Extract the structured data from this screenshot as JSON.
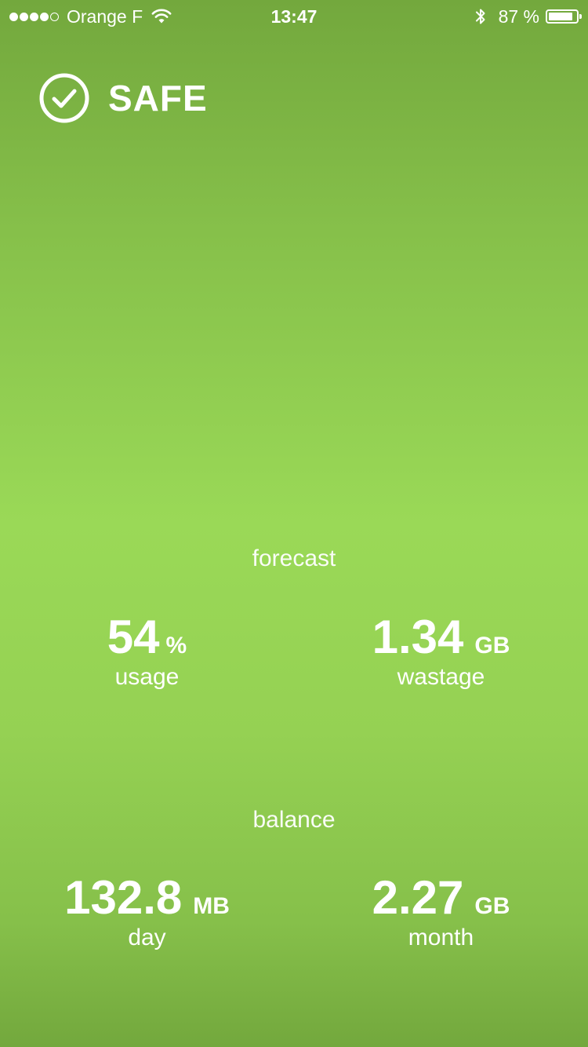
{
  "status_bar": {
    "carrier": "Orange F",
    "signal_bars_filled": 4,
    "signal_bars_total": 5,
    "time": "13:47",
    "battery_percent_text": "87 %",
    "battery_level": 0.87,
    "icons": [
      "wifi-icon",
      "bluetooth-icon",
      "battery-icon"
    ]
  },
  "header": {
    "status": "SAFE",
    "icon": "checkmark-circle-icon"
  },
  "forecast": {
    "title": "forecast",
    "usage": {
      "value": "54",
      "unit": "%",
      "label": "usage"
    },
    "wastage": {
      "value": "1.34",
      "unit": "GB",
      "label": "wastage"
    }
  },
  "balance": {
    "title": "balance",
    "day": {
      "value": "132.8",
      "unit": "MB",
      "label": "day"
    },
    "month": {
      "value": "2.27",
      "unit": "GB",
      "label": "month"
    }
  },
  "colors": {
    "background_top": "#73a83d",
    "background_mid": "#9ad957",
    "text": "#ffffff"
  }
}
